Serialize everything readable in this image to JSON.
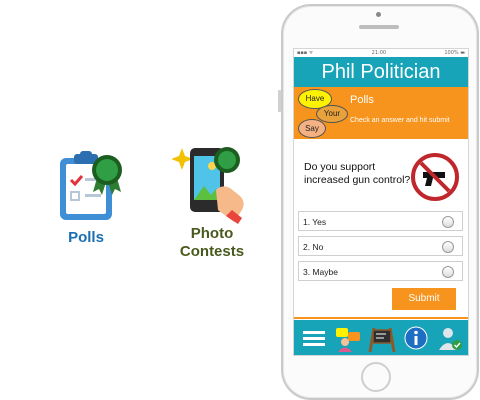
{
  "features": {
    "polls_label": "Polls",
    "photo_label": "Photo\nContests",
    "polls_color": "#1a6fb0",
    "photo_color": "#4a5a1e"
  },
  "phone": {
    "status": {
      "left": "▪▪▪ ᯤ",
      "time": "21:00",
      "battery": "100% ▬"
    },
    "app_title": "Phil Politician",
    "banner": {
      "bubble_have": "Have",
      "bubble_your": "Your",
      "bubble_say": "Say",
      "title": "Polls",
      "subtitle": "Check an answer and hit submit"
    },
    "question": "Do you support increased gun control?",
    "options": [
      "1. Yes",
      "2. No",
      "3. Maybe"
    ],
    "submit_label": "Submit",
    "nav_icons": [
      "menu-icon",
      "chat-icon",
      "board-icon",
      "info-icon",
      "profile-icon"
    ],
    "colors": {
      "teal": "#17a3b8",
      "orange": "#f7941d"
    }
  }
}
